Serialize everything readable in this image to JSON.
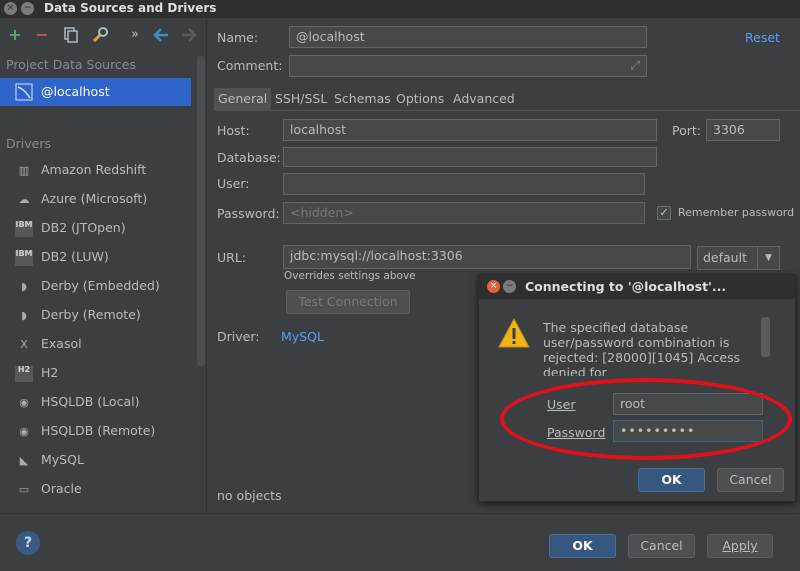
{
  "window": {
    "title": "Data Sources and Drivers",
    "close_glyph": "×",
    "min_glyph": "−"
  },
  "toolbar": {
    "add_icon": "+",
    "remove_icon": "−",
    "more_icon": "»"
  },
  "sidebar": {
    "project_label": "Project Data Sources",
    "datasource": "@localhost",
    "drivers_label": "Drivers",
    "drivers": [
      {
        "label": "Amazon Redshift",
        "icon": "amazon-redshift-icon",
        "glyph": "▥"
      },
      {
        "label": "Azure (Microsoft)",
        "icon": "azure-icon",
        "glyph": "☁"
      },
      {
        "label": "DB2 (JTOpen)",
        "icon": "db2-icon",
        "glyph": "IBM"
      },
      {
        "label": "DB2 (LUW)",
        "icon": "db2-icon",
        "glyph": "IBM"
      },
      {
        "label": "Derby (Embedded)",
        "icon": "derby-icon",
        "glyph": "◗"
      },
      {
        "label": "Derby (Remote)",
        "icon": "derby-icon",
        "glyph": "◗"
      },
      {
        "label": "Exasol",
        "icon": "exasol-icon",
        "glyph": "X"
      },
      {
        "label": "H2",
        "icon": "h2-icon",
        "glyph": "H2"
      },
      {
        "label": "HSQLDB (Local)",
        "icon": "hsqldb-icon",
        "glyph": "◉"
      },
      {
        "label": "HSQLDB (Remote)",
        "icon": "hsqldb-icon",
        "glyph": "◉"
      },
      {
        "label": "MySQL",
        "icon": "mysql-icon",
        "glyph": "◣"
      },
      {
        "label": "Oracle",
        "icon": "oracle-icon",
        "glyph": "▭"
      }
    ]
  },
  "form": {
    "name_label": "Name:",
    "name_value": "@localhost",
    "reset_label": "Reset",
    "comment_label": "Comment:",
    "tabs": [
      "General",
      "SSH/SSL",
      "Schemas",
      "Options",
      "Advanced"
    ],
    "host_label": "Host:",
    "host_value": "localhost",
    "port_label": "Port:",
    "port_value": "3306",
    "database_label": "Database:",
    "user_label": "User:",
    "password_label": "Password:",
    "password_placeholder": "<hidden>",
    "remember_password": "Remember password",
    "url_label": "URL:",
    "url_value": "jdbc:mysql://localhost:3306",
    "url_mode": "default",
    "overrides_note": "Overrides settings above",
    "test_connection": "Test Connection",
    "driver_label": "Driver:",
    "driver_value": "MySQL",
    "no_objects": "no objects"
  },
  "footer": {
    "help": "?",
    "ok": "OK",
    "cancel": "Cancel",
    "apply": "Apply"
  },
  "dialog": {
    "title": "Connecting to '@localhost'...",
    "message": "The specified database user/password combination is rejected: [28000][1045] Access denied for",
    "user_label": "User",
    "user_value": "root",
    "password_label": "Password",
    "password_value": "•••••••••",
    "ok": "OK",
    "cancel": "Cancel"
  },
  "colors": {
    "background": "#3c3f41",
    "selection": "#2f65ca",
    "link": "#589df6",
    "primary_button": "#365880",
    "highlight_ellipse": "#e3101a"
  }
}
